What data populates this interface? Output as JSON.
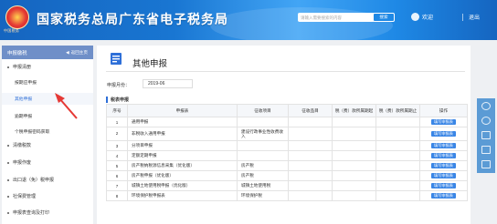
{
  "header": {
    "emblem_caption": "中国税务",
    "site_title": "国家税务总局广东省电子税务局",
    "search_placeholder": "请输入需要搜索的内容",
    "search_button": "搜索",
    "welcome": "欢迎",
    "logout": "退出"
  },
  "sidebar": {
    "title": "申报缴税",
    "back_label": "返回主页",
    "groups": [
      {
        "label": "申报清册"
      },
      {
        "label": "按期应申报"
      },
      {
        "label": "其他申报"
      },
      {
        "label": "逾期申报"
      },
      {
        "label": "个税申报密码获取"
      },
      {
        "label": "清缴税款"
      },
      {
        "label": "申报作废"
      },
      {
        "label": "出口退（免）税申报"
      },
      {
        "label": "社保费管理"
      },
      {
        "label": "申报表查询及打印"
      }
    ]
  },
  "main": {
    "title": "其他申报",
    "period_label": "申报月份：",
    "period_value": "2019-06",
    "section_title": "税表申报",
    "columns": [
      "序号",
      "申报表",
      "征收项目",
      "征收品目",
      "税（费）款所属期起",
      "税（费）款所属期止",
      "操作"
    ],
    "rows": [
      {
        "no": "1",
        "form": "通用申报",
        "item": "",
        "sub": "",
        "start": "",
        "end": "",
        "action": "填写申报表"
      },
      {
        "no": "2",
        "form": "非税收入通用申报",
        "item": "建设行政事业性收费收入",
        "sub": "",
        "start": "",
        "end": "",
        "action": "填写申报表"
      },
      {
        "no": "3",
        "form": "分项目申报",
        "item": "",
        "sub": "",
        "start": "",
        "end": "",
        "action": "填写申报表"
      },
      {
        "no": "4",
        "form": "定额定期申报",
        "item": "",
        "sub": "",
        "start": "",
        "end": "",
        "action": "填写申报表"
      },
      {
        "no": "5",
        "form": "房产税纳税源信息采集（优化版）",
        "item": "房产税",
        "sub": "",
        "start": "",
        "end": "",
        "action": "填写申报表"
      },
      {
        "no": "6",
        "form": "房产税申报（优化版）",
        "item": "房产税",
        "sub": "",
        "start": "",
        "end": "",
        "action": "填写申报表"
      },
      {
        "no": "7",
        "form": "城镇土地使用税申报（优化版）",
        "item": "城镇土地使用税",
        "sub": "",
        "start": "",
        "end": "",
        "action": "填写申报表"
      },
      {
        "no": "8",
        "form": "环境保护税申报表",
        "item": "环境保护税",
        "sub": "",
        "start": "",
        "end": "",
        "action": "填写申报表"
      }
    ]
  },
  "colors": {
    "header": "#1976d2",
    "sidebar_head": "#6f8fc8",
    "accent": "#2e6fd8",
    "button": "#3a86e6",
    "arrow": "#e53935"
  }
}
